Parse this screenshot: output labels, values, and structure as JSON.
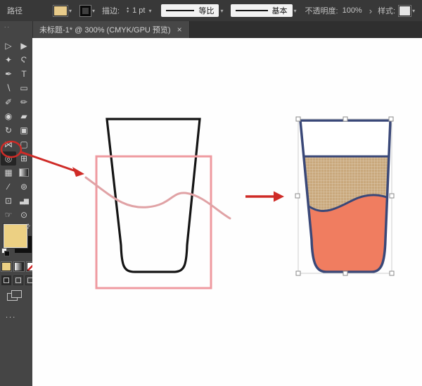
{
  "control_bar": {
    "panel_label": "路径",
    "fill_swatch_color": "#e8cb8a",
    "stroke_label": "描边:",
    "stroke_width_value": "1 pt",
    "width_profile_label": "等比",
    "brush_definition_label": "基本",
    "opacity_label": "不透明度:",
    "opacity_value": "100%",
    "style_label": "样式:"
  },
  "icons": {
    "chevron": "▾",
    "stepper_up": "▴",
    "stepper_down": "▾",
    "angle_right": "›",
    "swap": "⇄",
    "close": "×"
  },
  "tab_bar": {
    "document_title": "未标题-1* @ 300% (CMYK/GPU 预览)"
  },
  "toolbar": {
    "collapse_glyph": "..",
    "overflow_glyph": "...",
    "fill_color": "#ecd083",
    "tools": [
      {
        "name": "selection-tool",
        "glyph": "▷"
      },
      {
        "name": "direct-selection-tool",
        "glyph": "▶"
      },
      {
        "name": "magic-wand-tool",
        "glyph": "✦"
      },
      {
        "name": "lasso-tool",
        "glyph": "Ϛ"
      },
      {
        "name": "pen-tool",
        "glyph": "✒"
      },
      {
        "name": "type-tool",
        "glyph": "T"
      },
      {
        "name": "line-segment-tool",
        "glyph": "∖"
      },
      {
        "name": "rectangle-tool",
        "glyph": "▭"
      },
      {
        "name": "paintbrush-tool",
        "glyph": "✐"
      },
      {
        "name": "pencil-tool",
        "glyph": "✏"
      },
      {
        "name": "blob-brush-tool",
        "glyph": "◉"
      },
      {
        "name": "eraser-tool",
        "glyph": "▰"
      },
      {
        "name": "rotate-tool",
        "glyph": "↻"
      },
      {
        "name": "scale-tool",
        "glyph": "▣"
      },
      {
        "name": "width-tool",
        "glyph": "⋈"
      },
      {
        "name": "free-transform-tool",
        "glyph": "▢"
      },
      {
        "name": "shape-builder-tool",
        "glyph": "◎",
        "active": true
      },
      {
        "name": "perspective-grid-tool",
        "glyph": "⊞"
      },
      {
        "name": "mesh-tool",
        "glyph": "▦"
      },
      {
        "name": "gradient-tool",
        "glyph": ""
      },
      {
        "name": "eyedropper-tool",
        "glyph": "∕"
      },
      {
        "name": "symbol-sprayer-tool",
        "glyph": "⊚"
      },
      {
        "name": "artboard-tool",
        "glyph": "⊡"
      },
      {
        "name": "column-graph-tool",
        "glyph": "▃▆"
      },
      {
        "name": "hand-tool",
        "glyph": "☞"
      },
      {
        "name": "zoom-tool",
        "glyph": "⊙"
      }
    ]
  },
  "canvas": {
    "colors": {
      "glass_outline": "#141414",
      "highlight_rect": "#ef9aa0",
      "wave_stroke": "#e0a2a5",
      "annotation_red": "#cf2b27",
      "result_outline": "#3a4878",
      "liquid_fill": "#f07d60",
      "mesh_fill": "#c9a87c",
      "mesh_grid": "#ffffff",
      "handle_fill": "#ffffff",
      "handle_stroke": "#8a8a8a",
      "selection_bbox": "#cfcfcf"
    }
  }
}
